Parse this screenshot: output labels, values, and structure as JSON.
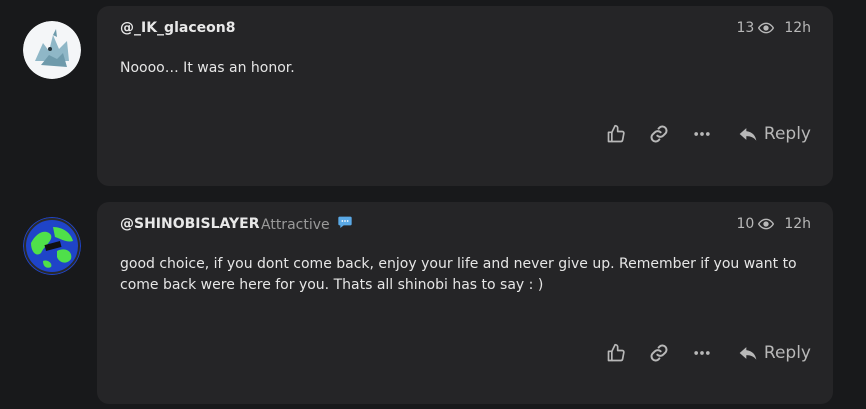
{
  "posts": [
    {
      "username": "@_IK_glaceon8",
      "user_title": "",
      "views": "13",
      "time": "12h",
      "body": "Noooo… It was an honor.",
      "reply_label": "Reply"
    },
    {
      "username": "@SHINOBISLAYER",
      "user_title": "Attractive",
      "views": "10",
      "time": "12h",
      "body": "good choice, if you dont come back, enjoy your life and never give up. Remember if you want to come back were here for you. Thats all shinobi has to say : )",
      "reply_label": "Reply"
    }
  ],
  "icons": {
    "views": "eye-icon",
    "like": "thumbs-up-icon",
    "link": "link-icon",
    "more": "ellipsis-icon",
    "reply": "reply-arrow-icon",
    "title_badge": "speech-bubble-icon"
  },
  "colors": {
    "background": "#18191b",
    "card": "#252527",
    "muted_text": "#b8b8b8",
    "title_badge": "#5aa9e6"
  }
}
